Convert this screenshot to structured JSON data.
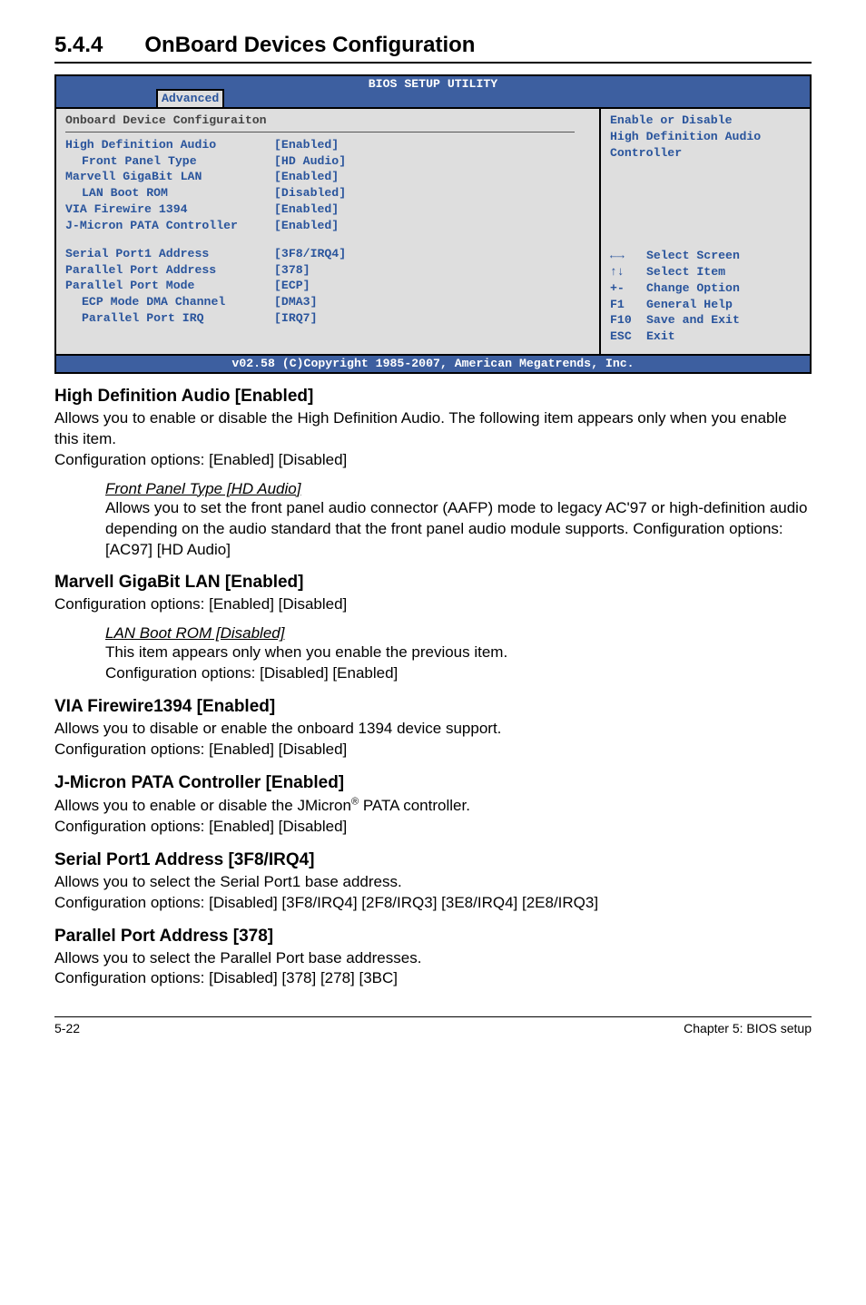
{
  "heading": {
    "number": "5.4.4",
    "title": "OnBoard Devices Configuration"
  },
  "bios": {
    "title": "BIOS SETUP UTILITY",
    "tab": "Advanced",
    "panel_title": "Onboard Device Configuraiton",
    "rows": [
      {
        "label": "High Definition Audio",
        "value": "[Enabled]",
        "indent": false
      },
      {
        "label": "Front Panel Type",
        "value": "[HD Audio]",
        "indent": true
      },
      {
        "label": "Marvell GigaBit LAN",
        "value": "[Enabled]",
        "indent": false
      },
      {
        "label": "LAN Boot ROM",
        "value": "[Disabled]",
        "indent": true
      },
      {
        "label": "VIA Firewire 1394",
        "value": "[Enabled]",
        "indent": false
      },
      {
        "label": "J-Micron PATA Controller",
        "value": "[Enabled]",
        "indent": false
      }
    ],
    "rows2": [
      {
        "label": "Serial Port1 Address",
        "value": "[3F8/IRQ4]",
        "indent": false
      },
      {
        "label": "Parallel Port Address",
        "value": "[378]",
        "indent": false
      },
      {
        "label": "Parallel Port Mode",
        "value": "[ECP]",
        "indent": false
      },
      {
        "label": "ECP Mode DMA Channel",
        "value": "[DMA3]",
        "indent": true
      },
      {
        "label": "Parallel Port IRQ",
        "value": "[IRQ7]",
        "indent": true
      }
    ],
    "help_top": "Enable or Disable\nHigh Definition Audio\nController",
    "help_keys": [
      {
        "key": "←→",
        "desc": "Select Screen"
      },
      {
        "key": "↑↓",
        "desc": "Select Item"
      },
      {
        "key": "+-",
        "desc": "Change Option"
      },
      {
        "key": "F1",
        "desc": "General Help"
      },
      {
        "key": "F10",
        "desc": "Save and Exit"
      },
      {
        "key": "ESC",
        "desc": "Exit"
      }
    ],
    "footer": "v02.58 (C)Copyright 1985-2007, American Megatrends, Inc."
  },
  "sections": [
    {
      "h": "High Definition Audio [Enabled]",
      "p": "Allows you to enable or disable the High Definition Audio. The following item appears only when you enable this item.\nConfiguration options: [Enabled] [Disabled]",
      "sub": {
        "h": "Front Panel Type [HD Audio]",
        "p": "Allows you to set the front panel audio connector (AAFP) mode to legacy AC'97 or high-definition audio depending on the audio standard that the front panel audio module supports. Configuration options: [AC97] [HD Audio]"
      }
    },
    {
      "h": "Marvell GigaBit LAN [Enabled]",
      "p": "Configuration options: [Enabled] [Disabled]",
      "sub": {
        "h": "LAN Boot ROM [Disabled]",
        "p": "This item appears only when you enable the previous item.\nConfiguration options: [Disabled] [Enabled]"
      }
    },
    {
      "h": "VIA Firewire1394 [Enabled]",
      "p": "Allows you to disable or enable the onboard 1394 device support.\nConfiguration options: [Enabled] [Disabled]"
    },
    {
      "h": "J-Micron PATA Controller [Enabled]",
      "p_html": "Allows you to enable or disable the JMicron<sup>®</sup> PATA controller.\nConfiguration options: [Enabled] [Disabled]"
    },
    {
      "h": "Serial Port1 Address [3F8/IRQ4]",
      "p": "Allows you to select the Serial Port1 base address.\nConfiguration options: [Disabled] [3F8/IRQ4] [2F8/IRQ3] [3E8/IRQ4] [2E8/IRQ3]"
    },
    {
      "h": "Parallel Port Address [378]",
      "p": "Allows you to select the Parallel Port base addresses.\nConfiguration options: [Disabled] [378] [278] [3BC]"
    }
  ],
  "footer": {
    "left": "5-22",
    "right": "Chapter 5: BIOS setup"
  }
}
